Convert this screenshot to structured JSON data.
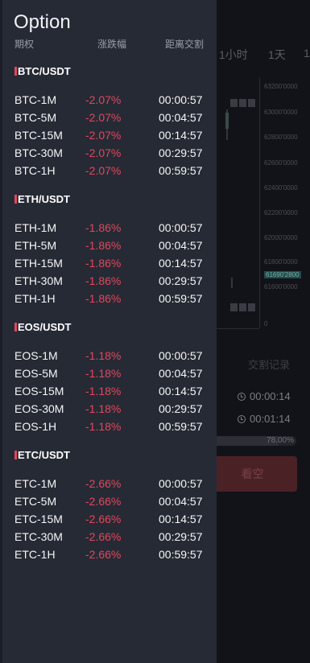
{
  "background": {
    "timeframes": [
      "1小时",
      "1天",
      "1"
    ],
    "axis_labels": [
      "63200'0000",
      "63000'0000",
      "62800'0000",
      "62600'0000",
      "62400'0000",
      "62200'0000",
      "62000'0000",
      "61800'0000",
      "61690'2800",
      "61600'0000",
      "0"
    ],
    "tab_label": "交割记录",
    "timers": [
      "00:00:14",
      "00:01:14"
    ],
    "progress_label": "78.00%",
    "progress_value": 0.78,
    "short_button": "看空"
  },
  "drawer": {
    "title": "Option",
    "col_period": "期权",
    "col_change": "涨跌幅",
    "col_time": "距离交割",
    "groups": [
      {
        "name": "BTC/USDT",
        "rows": [
          {
            "sym": "BTC-1M",
            "chg": "-2.07%",
            "time": "00:00:57"
          },
          {
            "sym": "BTC-5M",
            "chg": "-2.07%",
            "time": "00:04:57"
          },
          {
            "sym": "BTC-15M",
            "chg": "-2.07%",
            "time": "00:14:57"
          },
          {
            "sym": "BTC-30M",
            "chg": "-2.07%",
            "time": "00:29:57"
          },
          {
            "sym": "BTC-1H",
            "chg": "-2.07%",
            "time": "00:59:57"
          }
        ]
      },
      {
        "name": "ETH/USDT",
        "rows": [
          {
            "sym": "ETH-1M",
            "chg": "-1.86%",
            "time": "00:00:57"
          },
          {
            "sym": "ETH-5M",
            "chg": "-1.86%",
            "time": "00:04:57"
          },
          {
            "sym": "ETH-15M",
            "chg": "-1.86%",
            "time": "00:14:57"
          },
          {
            "sym": "ETH-30M",
            "chg": "-1.86%",
            "time": "00:29:57"
          },
          {
            "sym": "ETH-1H",
            "chg": "-1.86%",
            "time": "00:59:57"
          }
        ]
      },
      {
        "name": "EOS/USDT",
        "rows": [
          {
            "sym": "EOS-1M",
            "chg": "-1.18%",
            "time": "00:00:57"
          },
          {
            "sym": "EOS-5M",
            "chg": "-1.18%",
            "time": "00:04:57"
          },
          {
            "sym": "EOS-15M",
            "chg": "-1.18%",
            "time": "00:14:57"
          },
          {
            "sym": "EOS-30M",
            "chg": "-1.18%",
            "time": "00:29:57"
          },
          {
            "sym": "EOS-1H",
            "chg": "-1.18%",
            "time": "00:59:57"
          }
        ]
      },
      {
        "name": "ETC/USDT",
        "rows": [
          {
            "sym": "ETC-1M",
            "chg": "-2.66%",
            "time": "00:00:57"
          },
          {
            "sym": "ETC-5M",
            "chg": "-2.66%",
            "time": "00:04:57"
          },
          {
            "sym": "ETC-15M",
            "chg": "-2.66%",
            "time": "00:14:57"
          },
          {
            "sym": "ETC-30M",
            "chg": "-2.66%",
            "time": "00:29:57"
          },
          {
            "sym": "ETC-1H",
            "chg": "-2.66%",
            "time": "00:59:57"
          }
        ]
      }
    ]
  },
  "colors": {
    "drawer_bg": "#262a35",
    "negative": "#e2475b",
    "accent_bar": "#e0495c"
  }
}
